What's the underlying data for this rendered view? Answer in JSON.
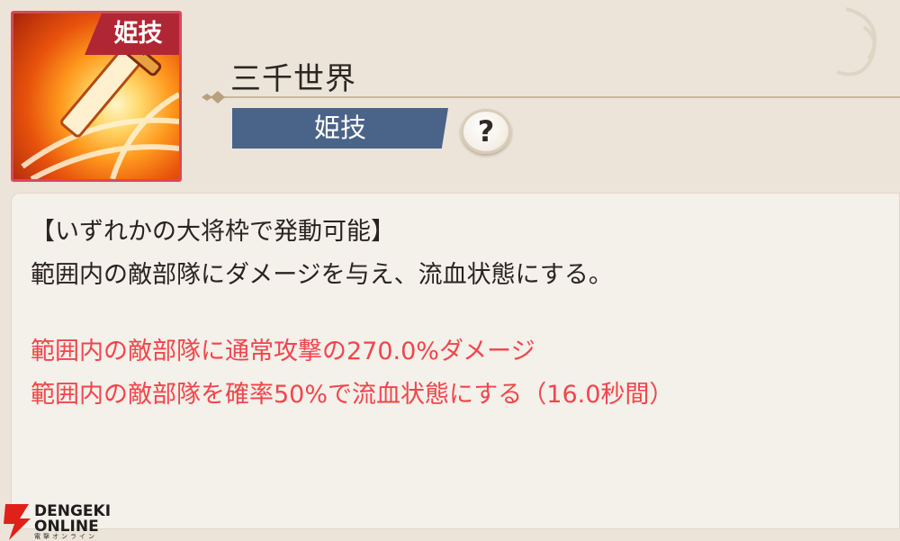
{
  "skill": {
    "badge": "姫技",
    "name": "三千世界",
    "type_label": "姫技",
    "help_label": "?"
  },
  "description": {
    "condition": "【いずれかの大将枠で発動可能】",
    "summary": "範囲内の敵部隊にダメージを与え、流血状態にする。",
    "effects": [
      "範囲内の敵部隊に通常攻撃の270.0%ダメージ",
      "範囲内の敵部隊を確率50%で流血状態にする（16.0秒間）"
    ]
  },
  "watermark": {
    "line1": "DENGEKI",
    "line2": "ONLINE",
    "line3": "電撃オンライン"
  },
  "colors": {
    "badge": "#b12634",
    "type_bar": "#4a6389",
    "effect_text": "#f2454b",
    "panel": "#f4f0ea"
  }
}
